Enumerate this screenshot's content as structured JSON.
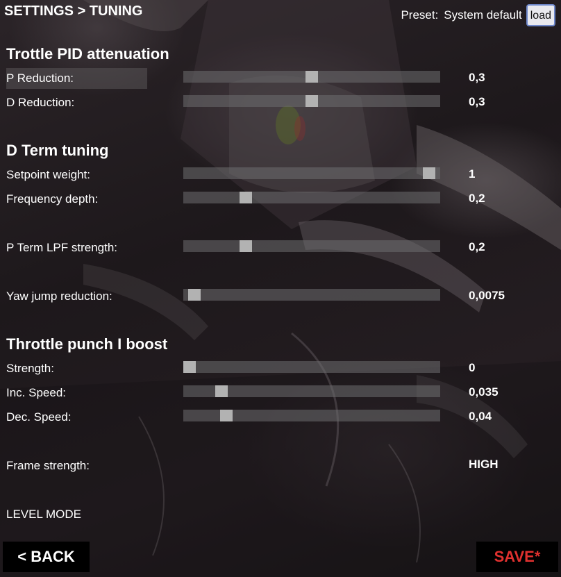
{
  "header": {
    "title": "SETTINGS > TUNING",
    "preset_label": "Preset:",
    "preset_value": "System default",
    "load_label": "load"
  },
  "sections": {
    "throttle_pid": "Trottle PID attenuation",
    "dterm": "D Term tuning",
    "punch": "Throttle punch I boost"
  },
  "rows": {
    "p_reduction": {
      "label": "P Reduction:",
      "value": "0,3",
      "level": 0.5
    },
    "d_reduction": {
      "label": "D Reduction:",
      "value": "0,3",
      "level": 0.5
    },
    "setpoint_weight": {
      "label": "Setpoint weight:",
      "value": "1",
      "level": 0.98
    },
    "frequency_depth": {
      "label": "Frequency depth:",
      "value": "0,2",
      "level": 0.23
    },
    "pterm_lpf": {
      "label": "P Term LPF strength:",
      "value": "0,2",
      "level": 0.23
    },
    "yaw_jump": {
      "label": "Yaw jump reduction:",
      "value": "0,0075",
      "level": 0.02
    },
    "strength": {
      "label": "Strength:",
      "value": "0",
      "level": 0.0
    },
    "inc_speed": {
      "label": "Inc. Speed:",
      "value": "0,035",
      "level": 0.13
    },
    "dec_speed": {
      "label": "Dec. Speed:",
      "value": "0,04",
      "level": 0.15
    },
    "frame_strength": {
      "label": "Frame strength:",
      "value": "HIGH"
    }
  },
  "level_mode": "LEVEL MODE",
  "footer": {
    "back_label": "< BACK",
    "save_label": "SAVE*"
  },
  "colors": {
    "save_text": "#e0312f",
    "thumb": "#b2b2b2",
    "load_border": "#6d86c9"
  }
}
